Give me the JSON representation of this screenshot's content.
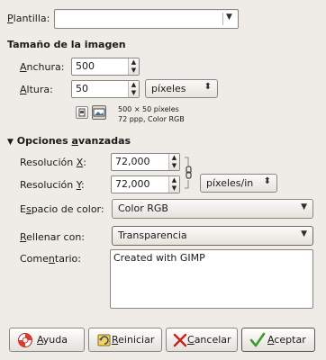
{
  "template": {
    "label": "Plantilla:",
    "mnemonic": "P",
    "rest": "lantilla:",
    "value": ""
  },
  "image_size": {
    "heading": "Tamaño de la imagen",
    "width_mn": "A",
    "width_rest": "nchura:",
    "width_value": "500",
    "height_mn": "A",
    "height_rest": "ltura:",
    "height_value": "50",
    "unit": "píxeles",
    "info_line1": "500 × 50 píxeles",
    "info_line2": "72 ppp, Color RGB"
  },
  "advanced": {
    "heading_pre": "Opciones ",
    "heading_mn": "a",
    "heading_rest": "vanzadas",
    "xres_pre": "Resolución ",
    "xres_mn": "X",
    "xres_post": ":",
    "xres_value": "72,000",
    "yres_pre": "Resolución ",
    "yres_mn": "Y",
    "yres_post": ":",
    "yres_value": "72,000",
    "res_unit": "píxeles/in",
    "colorspace_pre": "E",
    "colorspace_mn": "s",
    "colorspace_rest": "pacio de color:",
    "colorspace_value": "Color RGB",
    "fill_mn": "R",
    "fill_rest": "ellenar con:",
    "fill_value": "Transparencia",
    "comment_pre": "Come",
    "comment_mn": "n",
    "comment_rest": "tario:",
    "comment_value": "Created with GIMP"
  },
  "buttons": {
    "help_mn": "A",
    "help_rest": "yuda",
    "reset_mn": "R",
    "reset_rest": "einiciar",
    "cancel_mn": "C",
    "cancel_rest": "ancelar",
    "ok_mn": "A",
    "ok_rest": "ceptar"
  },
  "colors": {
    "background": "#efebe7",
    "help_icon": "#e03a2e",
    "cancel_icon": "#c8201a",
    "ok_icon": "#3a9c2a"
  },
  "icons": [
    "portrait-icon",
    "landscape-icon",
    "chain-link-icon",
    "lifebuoy-icon",
    "reset-icon",
    "cancel-x-icon",
    "ok-check-icon"
  ]
}
